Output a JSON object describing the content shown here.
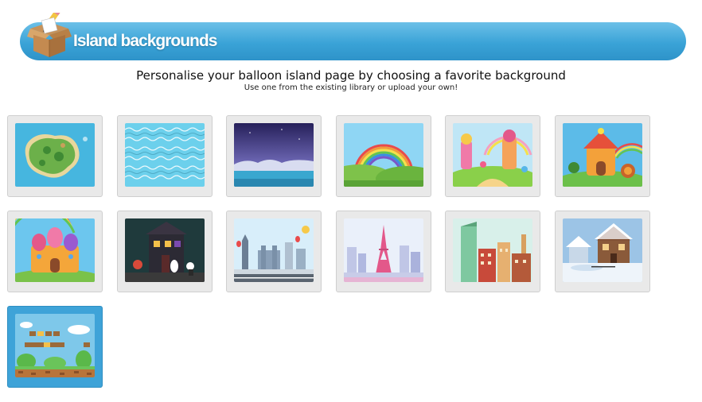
{
  "header": {
    "title": "Island backgrounds",
    "icon": "open-box-with-pencil-icon",
    "color": "#3aa3d7"
  },
  "intro": {
    "heading": "Personalise your balloon island page by choosing a favorite background",
    "hint": "Use one from the existing library or upload your own!"
  },
  "backgrounds": [
    {
      "name": "island-map"
    },
    {
      "name": "waves"
    },
    {
      "name": "night-sea"
    },
    {
      "name": "rainbow-hills"
    },
    {
      "name": "candy-land"
    },
    {
      "name": "candy-house"
    },
    {
      "name": "candy-castle"
    },
    {
      "name": "haunted-house"
    },
    {
      "name": "london"
    },
    {
      "name": "paris"
    },
    {
      "name": "city-skyline"
    },
    {
      "name": "snowy-village"
    },
    {
      "name": "platformer-level",
      "selected": true
    }
  ],
  "selected_color": "#3ea3d8"
}
